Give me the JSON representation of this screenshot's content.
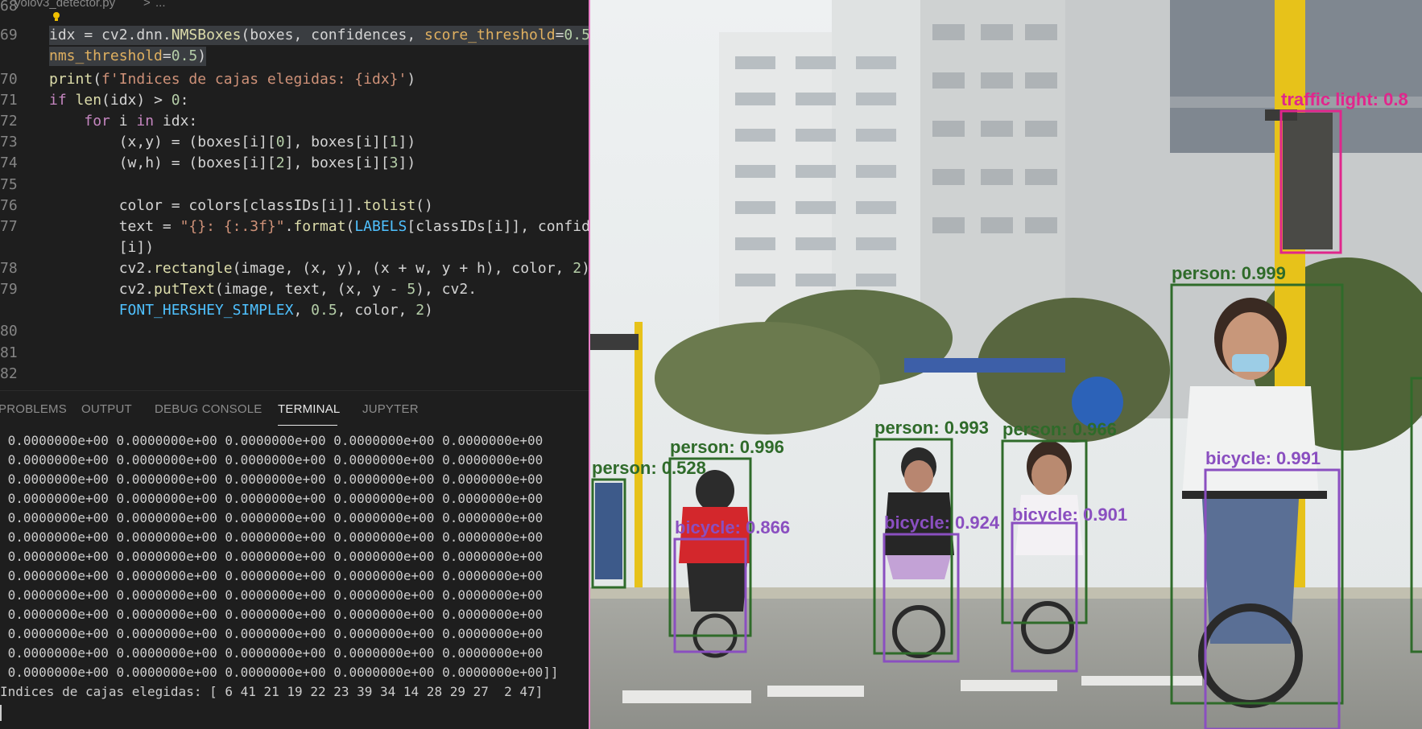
{
  "breadcrumb": {
    "file": "yolov3_detector.py",
    "sep": ">",
    "more": "..."
  },
  "editor": {
    "lines": [
      {
        "num": "68",
        "text": ""
      },
      {
        "num": "69",
        "text": "idx = cv2.dnn.NMSBoxes(boxes, confidences, score_threshold=0.5,"
      },
      {
        "num": "",
        "text": "nms_threshold=0.5)"
      },
      {
        "num": "70",
        "text": "print(f'Indices de cajas elegidas: {idx}')"
      },
      {
        "num": "71",
        "text": "if len(idx) > 0:"
      },
      {
        "num": "72",
        "text": "    for i in idx:"
      },
      {
        "num": "73",
        "text": "        (x,y) = (boxes[i][0], boxes[i][1])"
      },
      {
        "num": "74",
        "text": "        (w,h) = (boxes[i][2], boxes[i][3])"
      },
      {
        "num": "75",
        "text": ""
      },
      {
        "num": "76",
        "text": "        color = colors[classIDs[i]].tolist()"
      },
      {
        "num": "77",
        "text": "        text = \"{}: {:.3f}\".format(LABELS[classIDs[i]], confide"
      },
      {
        "num": "",
        "text": "        [i])"
      },
      {
        "num": "78",
        "text": "        cv2.rectangle(image, (x, y), (x + w, y + h), color, 2)"
      },
      {
        "num": "79",
        "text": "        cv2.putText(image, text, (x, y - 5), cv2."
      },
      {
        "num": "",
        "text": "        FONT_HERSHEY_SIMPLEX, 0.5, color, 2)"
      },
      {
        "num": "80",
        "text": ""
      },
      {
        "num": "81",
        "text": ""
      },
      {
        "num": "82",
        "text": ""
      }
    ]
  },
  "panel_tabs": [
    {
      "label": "PROBLEMS",
      "active": false
    },
    {
      "label": "OUTPUT",
      "active": false
    },
    {
      "label": "DEBUG CONSOLE",
      "active": false
    },
    {
      "label": "TERMINAL",
      "active": true
    },
    {
      "label": "JUPYTER",
      "active": false
    }
  ],
  "terminal": {
    "row_text": " 0.0000000e+00 0.0000000e+00 0.0000000e+00 0.0000000e+00 0.0000000e+00",
    "last_row_text": " 0.0000000e+00 0.0000000e+00 0.0000000e+00 0.0000000e+00 0.0000000e+00]]",
    "indices_line": "Indices de cajas elegidas: [ 6 41 21 19 22 23 39 34 14 28 29 27  2 47]",
    "lines": [
      " 0.0000000e+00 0.0000000e+00 0.0000000e+00 0.0000000e+00 0.0000000e+00",
      " 0.0000000e+00 0.0000000e+00 0.0000000e+00 0.0000000e+00 0.0000000e+00",
      " 0.0000000e+00 0.0000000e+00 0.0000000e+00 0.0000000e+00 0.0000000e+00",
      " 0.0000000e+00 0.0000000e+00 0.0000000e+00 0.0000000e+00 0.0000000e+00",
      " 0.0000000e+00 0.0000000e+00 0.0000000e+00 0.0000000e+00 0.0000000e+00",
      " 0.0000000e+00 0.0000000e+00 0.0000000e+00 0.0000000e+00 0.0000000e+00",
      " 0.0000000e+00 0.0000000e+00 0.0000000e+00 0.0000000e+00 0.0000000e+00",
      " 0.0000000e+00 0.0000000e+00 0.0000000e+00 0.0000000e+00 0.0000000e+00",
      " 0.0000000e+00 0.0000000e+00 0.0000000e+00 0.0000000e+00 0.0000000e+00",
      " 0.0000000e+00 0.0000000e+00 0.0000000e+00 0.0000000e+00 0.0000000e+00",
      " 0.0000000e+00 0.0000000e+00 0.0000000e+00 0.0000000e+00 0.0000000e+00",
      " 0.0000000e+00 0.0000000e+00 0.0000000e+00 0.0000000e+00 0.0000000e+00",
      " 0.0000000e+00 0.0000000e+00 0.0000000e+00 0.0000000e+00 0.0000000e+00]]",
      "Indices de cajas elegidas: [ 6 41 21 19 22 23 39 34 14 28 29 27  2 47]"
    ]
  },
  "detections": [
    {
      "label": "traffic light: 0.8",
      "color": "#e0268c"
    },
    {
      "label": "person: 0.999",
      "color": "#2f6b2a"
    },
    {
      "label": "bicycle: 0.991",
      "color": "#8a4fc0"
    },
    {
      "label": "person: 0.993",
      "color": "#2f6b2a"
    },
    {
      "label": "person: 0.966",
      "color": "#2f6b2a"
    },
    {
      "label": "person: 0.996",
      "color": "#2f6b2a"
    },
    {
      "label": "person: 0.528",
      "color": "#2f6b2a"
    },
    {
      "label": "bicycle: 0.866",
      "color": "#8a4fc0"
    },
    {
      "label": "bicycle: 0.924",
      "color": "#8a4fc0"
    },
    {
      "label": "bicycle: 0.901",
      "color": "#8a4fc0"
    }
  ]
}
